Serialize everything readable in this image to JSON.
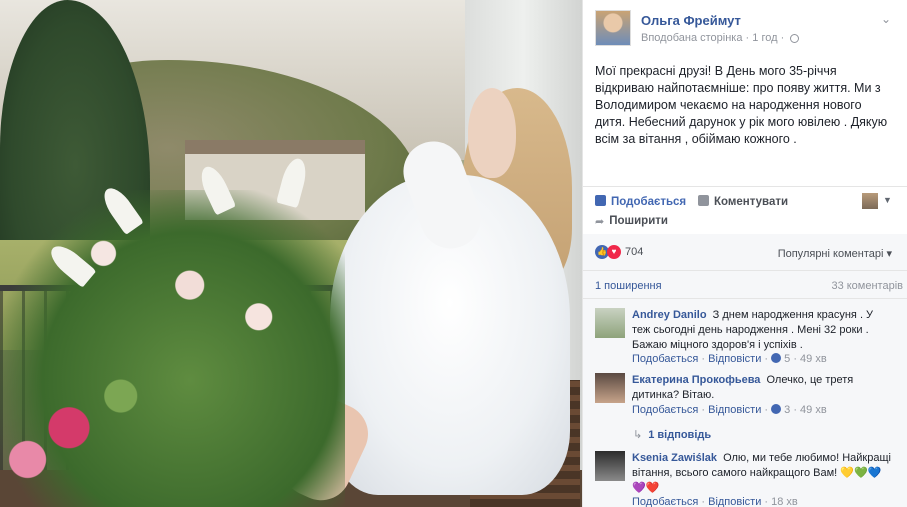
{
  "post": {
    "author": "Ольга Фреймут",
    "meta_liked": "Вподобана сторінка",
    "meta_sep": "·",
    "meta_time": "1 год",
    "text": "Мої прекрасні друзі! В День мого 35-річчя відкриваю найпотаємніше: про появу життя. Ми з Володимиром чекаємо на народження нового дитя. Небесний дарунок у рік мого ювілею . Дякую всім за вітання , обіймаю кожного ."
  },
  "actions": {
    "like": "Подобається",
    "comment": "Коментувати",
    "share": "Поширити"
  },
  "reactions": {
    "count": "704",
    "sort_label": "Популярні коментарі ▾"
  },
  "stats": {
    "shares": "1 поширення",
    "comments": "33 коментарів"
  },
  "comments": [
    {
      "name": "Andrey Danilo",
      "text": "З днем народження красуня . У теж сьогодні день народження . Мені 32 роки . Бажаю міцного здоров'я і успіхів .",
      "like": "Подобається",
      "reply": "Відповісти",
      "likes": "5",
      "time": "49 хв"
    },
    {
      "name": "Екатерина Прокофьева",
      "text": "Олечко, це третя дитинка? Вітаю.",
      "like": "Подобається",
      "reply": "Відповісти",
      "likes": "3",
      "time": "49 хв",
      "replies": "1 відповідь"
    },
    {
      "name": "Ksenia Zawiślak",
      "text": "Олю, ми тебе любимо! Найкращі вітання, всього самого найкращого Вам! 💛💚💙💜❤️",
      "like": "Подобається",
      "reply": "Відповісти",
      "time": "18 хв"
    }
  ],
  "colors": {
    "link": "#365899",
    "accent": "#4267b2",
    "love": "#f0284a",
    "muted": "#90949c"
  }
}
